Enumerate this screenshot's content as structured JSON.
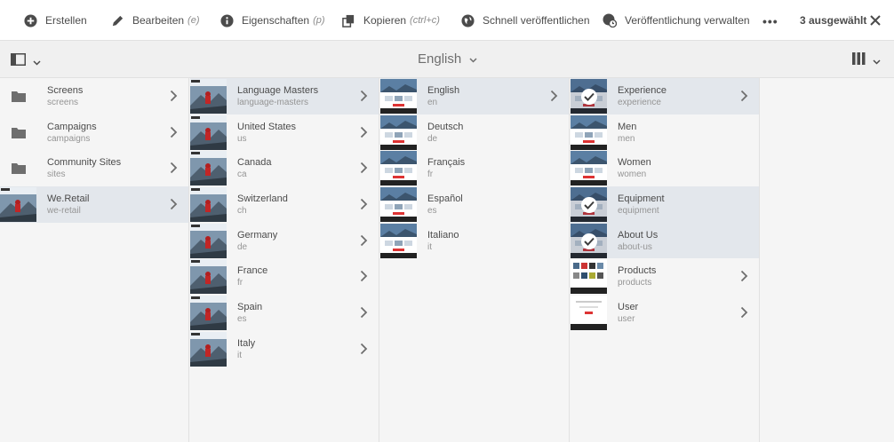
{
  "toolbar": {
    "create": "Erstellen",
    "edit": "Bearbeiten",
    "edit_shortcut": "(e)",
    "properties": "Eigenschaften",
    "properties_shortcut": "(p)",
    "copy": "Kopieren",
    "copy_shortcut": "(ctrl+c)",
    "quick_publish": "Schnell veröffentlichen",
    "manage_publication": "Veröffentlichung verwalten",
    "more": "•••",
    "selection_count": "3 ausgewählt"
  },
  "breadcrumb": {
    "current": "English"
  },
  "columns": [
    {
      "items": [
        {
          "title": "Screens",
          "subtitle": "screens",
          "thumb": "folder",
          "arrow": true,
          "selected": false
        },
        {
          "title": "Campaigns",
          "subtitle": "campaigns",
          "thumb": "folder",
          "arrow": true,
          "selected": false
        },
        {
          "title": "Community Sites",
          "subtitle": "sites",
          "thumb": "folder",
          "arrow": true,
          "selected": false
        },
        {
          "title": "We.Retail",
          "subtitle": "we-retail",
          "thumb": "climber",
          "arrow": true,
          "selected": true
        }
      ]
    },
    {
      "items": [
        {
          "title": "Language Masters",
          "subtitle": "language-masters",
          "thumb": "climber",
          "arrow": true,
          "selected": true
        },
        {
          "title": "United States",
          "subtitle": "us",
          "thumb": "climber",
          "arrow": true,
          "selected": false
        },
        {
          "title": "Canada",
          "subtitle": "ca",
          "thumb": "climber",
          "arrow": true,
          "selected": false
        },
        {
          "title": "Switzerland",
          "subtitle": "ch",
          "thumb": "climber",
          "arrow": true,
          "selected": false
        },
        {
          "title": "Germany",
          "subtitle": "de",
          "thumb": "climber",
          "arrow": true,
          "selected": false
        },
        {
          "title": "France",
          "subtitle": "fr",
          "thumb": "climber",
          "arrow": true,
          "selected": false
        },
        {
          "title": "Spain",
          "subtitle": "es",
          "thumb": "climber",
          "arrow": true,
          "selected": false
        },
        {
          "title": "Italy",
          "subtitle": "it",
          "thumb": "climber",
          "arrow": true,
          "selected": false
        }
      ]
    },
    {
      "items": [
        {
          "title": "English",
          "subtitle": "en",
          "thumb": "site",
          "arrow": true,
          "selected": true
        },
        {
          "title": "Deutsch",
          "subtitle": "de",
          "thumb": "site",
          "arrow": false,
          "selected": false
        },
        {
          "title": "Français",
          "subtitle": "fr",
          "thumb": "site",
          "arrow": false,
          "selected": false
        },
        {
          "title": "Español",
          "subtitle": "es",
          "thumb": "site",
          "arrow": false,
          "selected": false
        },
        {
          "title": "Italiano",
          "subtitle": "it",
          "thumb": "site",
          "arrow": false,
          "selected": false
        }
      ]
    },
    {
      "items": [
        {
          "title": "Experience",
          "subtitle": "experience",
          "thumb": "site",
          "arrow": true,
          "selected": true,
          "checked": true
        },
        {
          "title": "Men",
          "subtitle": "men",
          "thumb": "site",
          "arrow": false,
          "selected": false
        },
        {
          "title": "Women",
          "subtitle": "women",
          "thumb": "site",
          "arrow": false,
          "selected": false
        },
        {
          "title": "Equipment",
          "subtitle": "equipment",
          "thumb": "site",
          "arrow": false,
          "selected": true,
          "checked": true
        },
        {
          "title": "About Us",
          "subtitle": "about-us",
          "thumb": "site",
          "arrow": false,
          "selected": true,
          "checked": true
        },
        {
          "title": "Products",
          "subtitle": "products",
          "thumb": "products",
          "arrow": true,
          "selected": false
        },
        {
          "title": "User",
          "subtitle": "user",
          "thumb": "user",
          "arrow": true,
          "selected": false
        }
      ]
    }
  ]
}
